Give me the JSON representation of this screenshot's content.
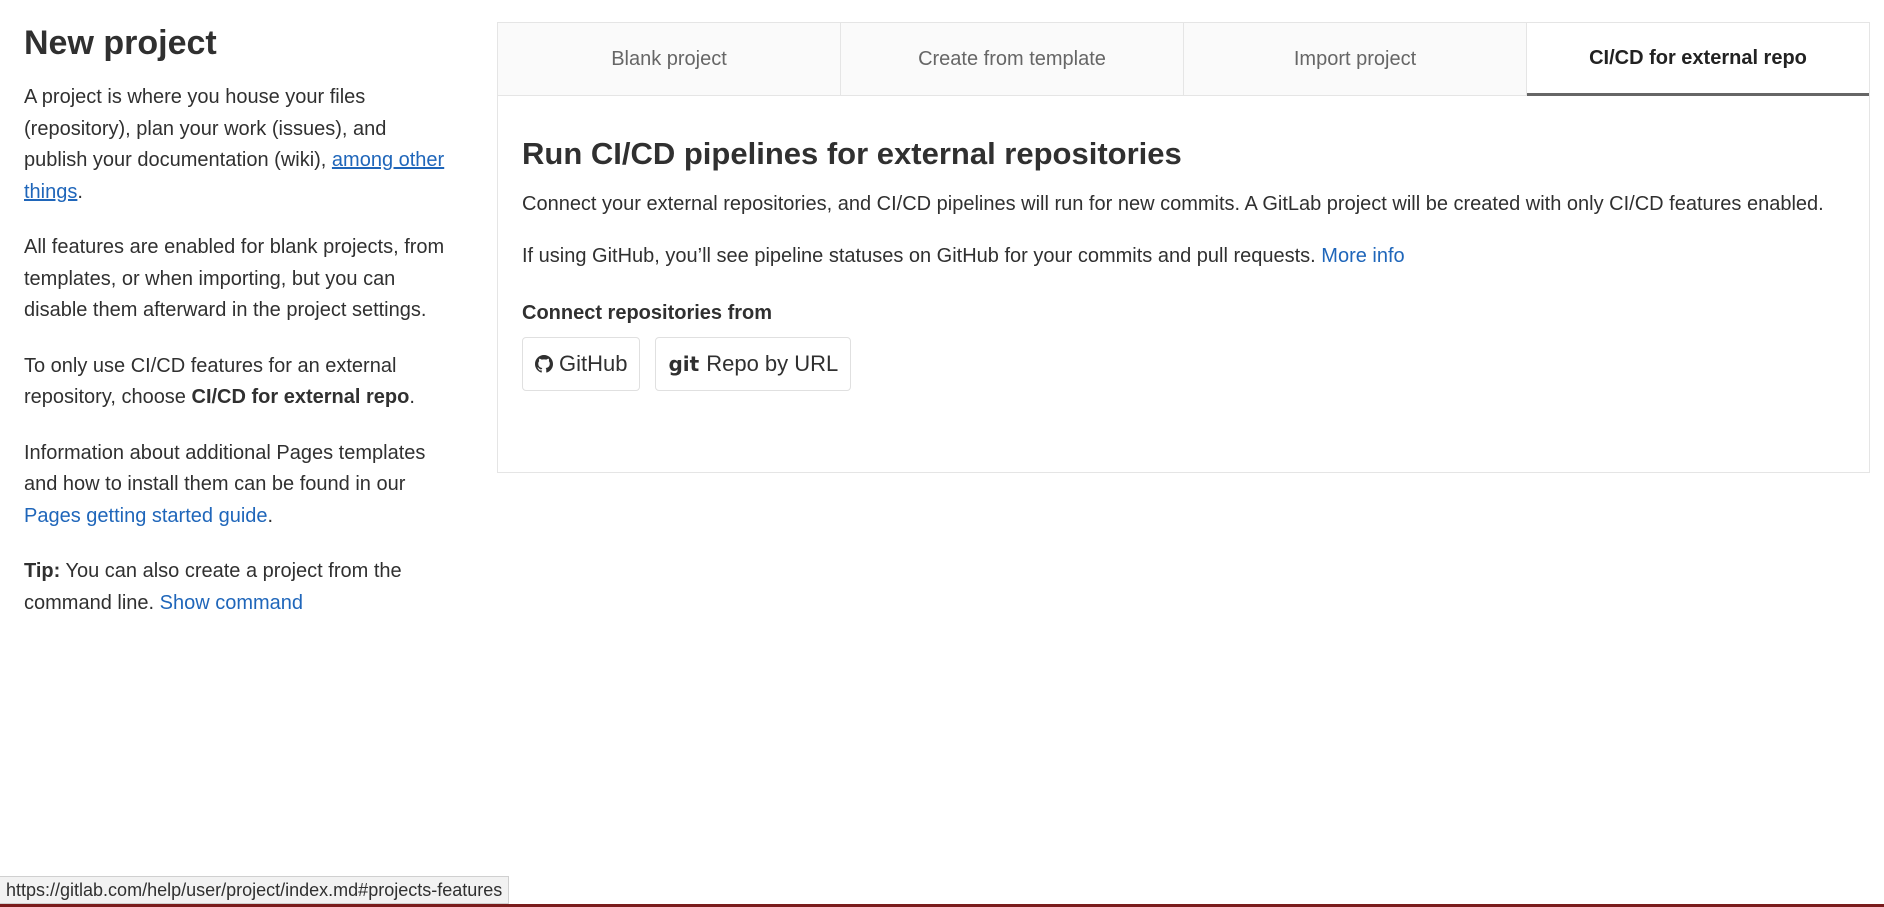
{
  "left": {
    "title": "New project",
    "p1_text": "A project is where you house your files (repository), plan your work (issues), and publish your documentation (wiki), ",
    "p1_link": "among other things",
    "p1_end": ".",
    "p2": "All features are enabled for blank projects, from templates, or when importing, but you can disable them afterward in the project settings.",
    "p3_text": "To only use CI/CD features for an external repository, choose ",
    "p3_bold": "CI/CD for external repo",
    "p3_end": ".",
    "p4_text": "Information about additional Pages templates and how to install them can be found in our ",
    "p4_link": "Pages getting started guide",
    "p4_end": ".",
    "tip_label": "Tip:",
    "tip_text": " You can also create a project from the command line. ",
    "tip_link": "Show command"
  },
  "tabs": [
    {
      "label": "Blank project"
    },
    {
      "label": "Create from template"
    },
    {
      "label": "Import project"
    },
    {
      "label": "CI/CD for external repo"
    }
  ],
  "content": {
    "heading": "Run CI/CD pipelines for external repositories",
    "p1": "Connect your external repositories, and CI/CD pipelines will run for new commits. A GitLab project will be created with only CI/CD features enabled.",
    "p2_text": "If using GitHub, you’ll see pipeline statuses on GitHub for your commits and pull requests. ",
    "p2_link": "More info",
    "connect_label": "Connect repositories from",
    "buttons": [
      {
        "label": "GitHub",
        "icon": "github-icon"
      },
      {
        "label": "Repo by URL",
        "icon": "git-icon",
        "icon_text": "git"
      }
    ]
  },
  "status_url": "https://gitlab.com/help/user/project/index.md#projects-features",
  "colors": {
    "link": "#1f66ba",
    "text": "#303030",
    "bottom_line": "#7a1c1c"
  }
}
